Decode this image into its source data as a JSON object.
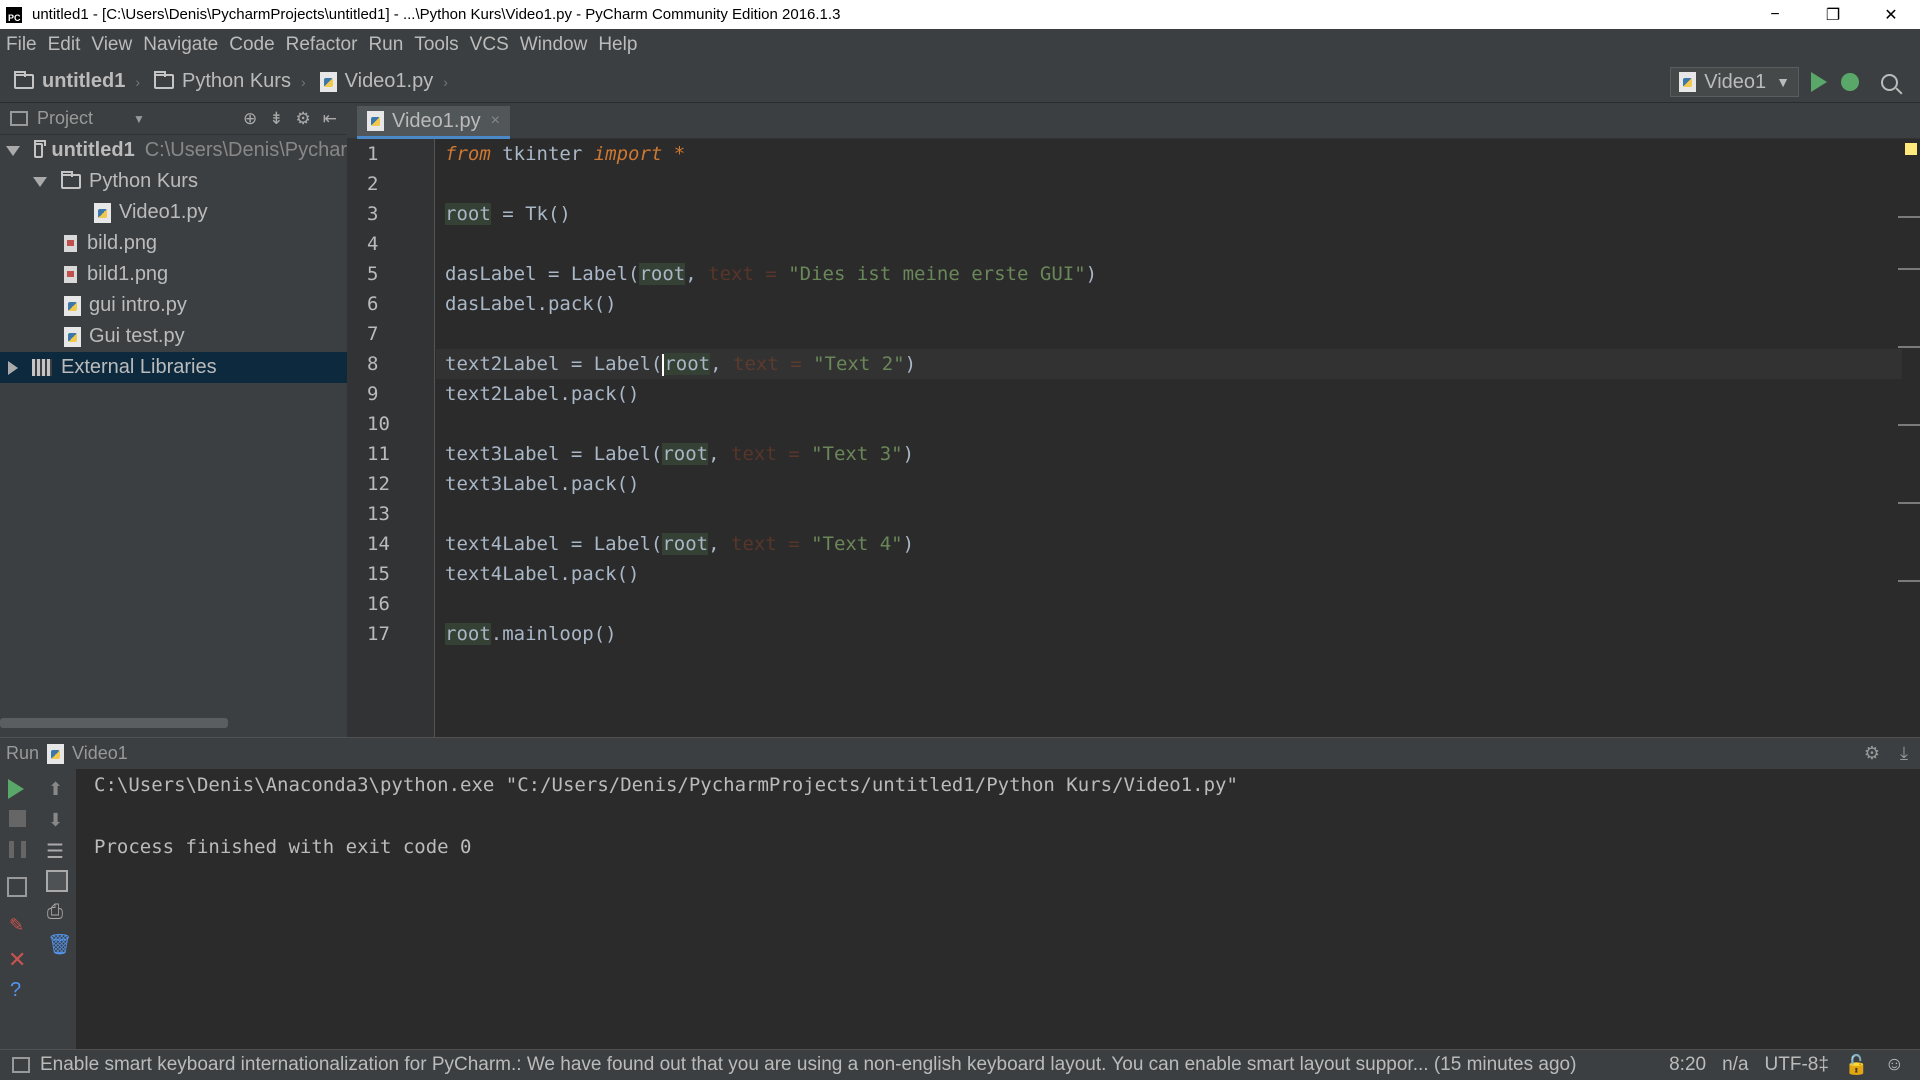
{
  "window": {
    "title": "untitled1 - [C:\\Users\\Denis\\PycharmProjects\\untitled1] - ...\\Python Kurs\\Video1.py - PyCharm Community Edition 2016.1.3",
    "minimize": "−",
    "maximize": "❐",
    "close": "✕"
  },
  "menu": [
    "File",
    "Edit",
    "View",
    "Navigate",
    "Code",
    "Refactor",
    "Run",
    "Tools",
    "VCS",
    "Window",
    "Help"
  ],
  "breadcrumbs": [
    "untitled1",
    "Python Kurs",
    "Video1.py"
  ],
  "run_config": {
    "label": "Video1"
  },
  "project_panel": {
    "title": "Project",
    "tree": [
      {
        "label": "untitled1",
        "path": "C:\\Users\\Denis\\Pychar"
      },
      {
        "label": "Python Kurs"
      },
      {
        "label": "Video1.py"
      },
      {
        "label": "bild.png"
      },
      {
        "label": "bild1.png"
      },
      {
        "label": "gui intro.py"
      },
      {
        "label": "Gui test.py"
      },
      {
        "label": "External Libraries"
      }
    ]
  },
  "editor": {
    "tab_label": "Video1.py",
    "tab_close": "×",
    "line_numbers": [
      "1",
      "2",
      "3",
      "4",
      "5",
      "6",
      "7",
      "8",
      "9",
      "10",
      "11",
      "12",
      "13",
      "14",
      "15",
      "16",
      "17"
    ],
    "code": {
      "l1": {
        "from": "from",
        "mod": " tkinter ",
        "import": "import",
        "star": " *"
      },
      "l3": {
        "root": "root",
        "rest": " = Tk()"
      },
      "l5": {
        "a": "dasLabel = Label(",
        "root": "root",
        "comma": ", ",
        "param": "text",
        "eq": " = ",
        "str": "\"Dies ist meine erste GUI\"",
        "close": ")"
      },
      "l6": "dasLabel.pack()",
      "l8": {
        "a": "text2Label = Label(",
        "root": "root",
        "comma": ", ",
        "param": "text",
        "eq": " = ",
        "str": "\"Text 2\"",
        "close": ")"
      },
      "l9": "text2Label.pack()",
      "l11": {
        "a": "text3Label = Label(",
        "root": "root",
        "comma": ", ",
        "param": "text",
        "eq": " = ",
        "str": "\"Text 3\"",
        "close": ")"
      },
      "l12": "text3Label.pack()",
      "l14": {
        "a": "text4Label = Label(",
        "root": "root",
        "comma": ", ",
        "param": "text",
        "eq": " = ",
        "str": "\"Text 4\"",
        "close": ")"
      },
      "l15": "text4Label.pack()",
      "l17": {
        "root": "root",
        "rest": ".mainloop()"
      }
    }
  },
  "run_panel": {
    "title": "Run",
    "config": "Video1",
    "console": [
      "C:\\Users\\Denis\\Anaconda3\\python.exe \"C:/Users/Denis/PycharmProjects/untitled1/Python Kurs/Video1.py\"",
      "",
      "Process finished with exit code 0"
    ]
  },
  "status_bar": {
    "message": "Enable smart keyboard internationalization for PyCharm.: We have found out that you are using a non-english keyboard layout. You can enable smart layout suppor... (15 minutes ago)",
    "position": "8:20",
    "line_sep": "n/a",
    "encoding": "UTF-8‡"
  },
  "colors": {
    "background": "#2b2b2b",
    "panel": "#3c3f41",
    "keyword": "#cc7832",
    "string": "#6a8759",
    "run_green": "#59a869",
    "selection": "#0d293e"
  },
  "icons": [
    "folder-icon",
    "python-file-icon",
    "image-file-icon",
    "library-icon",
    "run-icon",
    "debug-icon",
    "search-icon",
    "stop-icon",
    "close-icon",
    "gear-icon"
  ]
}
